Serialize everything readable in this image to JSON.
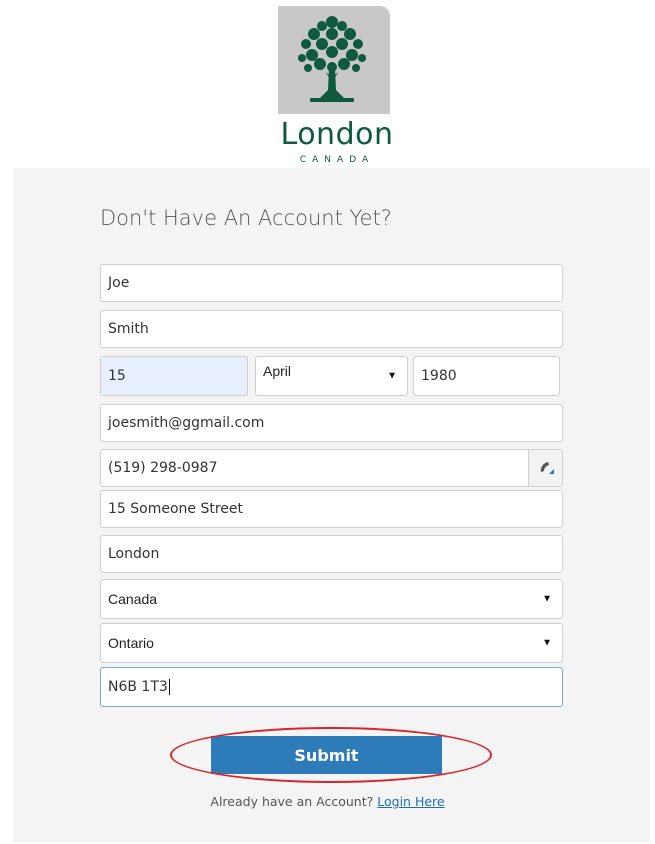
{
  "logo": {
    "name": "London",
    "sub": "CANADA"
  },
  "heading": "Don't Have An Account Yet?",
  "form": {
    "first_name": "Joe",
    "last_name": "Smith",
    "birth_day": "15",
    "birth_month": "April",
    "birth_year": "1980",
    "email": "joesmith@ggmail.com",
    "phone": "(519) 298-0987",
    "address": "15 Someone Street",
    "city": "London",
    "country": "Canada",
    "province": "Ontario",
    "postal_code": "N6B 1T3"
  },
  "submit_label": "Submit",
  "footer": {
    "prompt": "Already have an Account?",
    "link": "Login Here"
  },
  "colors": {
    "brand_green": "#0f5a3e",
    "submit_blue": "#2d7bb8",
    "annotation_red": "#d9232d"
  }
}
